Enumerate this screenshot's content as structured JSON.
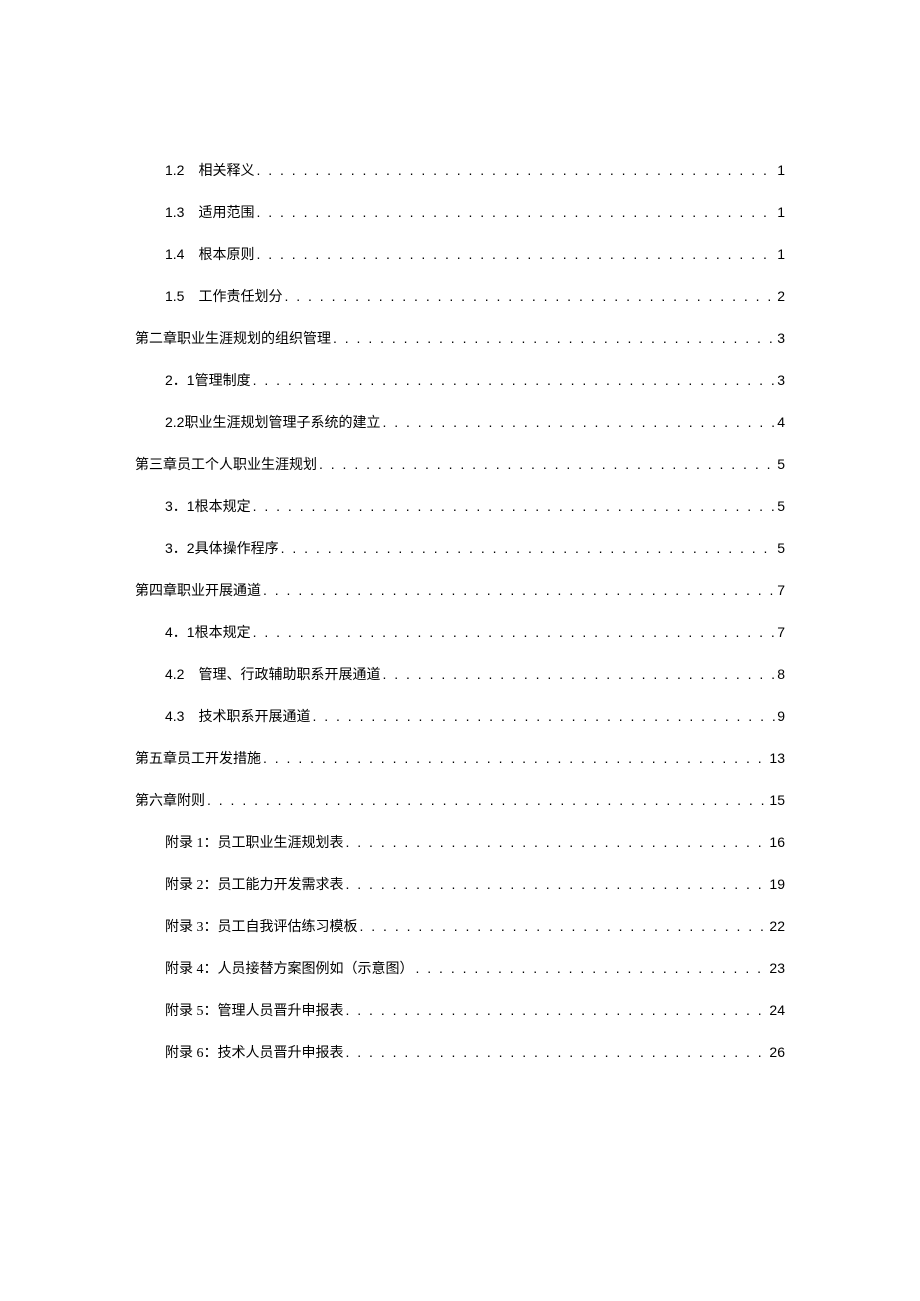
{
  "toc": [
    {
      "level": 2,
      "number": "1.2",
      "title": "相关释义",
      "page": "1",
      "gap": true
    },
    {
      "level": 2,
      "number": "1.3",
      "title": "适用范围",
      "page": "1",
      "gap": true
    },
    {
      "level": 2,
      "number": "1.4",
      "title": "根本原则",
      "page": "1",
      "gap": true
    },
    {
      "level": 2,
      "number": "1.5",
      "title": "工作责任划分",
      "page": "2",
      "gap": true
    },
    {
      "level": 1,
      "number": "",
      "title": "第二章职业生涯规划的组织管理",
      "page": "3",
      "gap": false
    },
    {
      "level": 2,
      "number": "2．1",
      "title": " 管理制度",
      "page": "3",
      "gap": false
    },
    {
      "level": 2,
      "number": "2.2",
      "title": " 职业生涯规划管理子系统的建立",
      "page": "4",
      "gap": false
    },
    {
      "level": 1,
      "number": "",
      "title": "第三章员工个人职业生涯规划",
      "page": "5",
      "gap": false
    },
    {
      "level": 2,
      "number": "3．1",
      "title": " 根本规定",
      "page": "5",
      "gap": false
    },
    {
      "level": 2,
      "number": "3．2",
      "title": " 具体操作程序",
      "page": "5",
      "gap": false
    },
    {
      "level": 1,
      "number": "",
      "title": "第四章职业开展通道",
      "page": "7",
      "gap": false
    },
    {
      "level": 2,
      "number": "4．1",
      "title": " 根本规定",
      "page": "7",
      "gap": false
    },
    {
      "level": 2,
      "number": "4.2",
      "title": "管理、行政辅助职系开展通道",
      "page": "8",
      "gap": true
    },
    {
      "level": 2,
      "number": "4.3",
      "title": "技术职系开展通道",
      "page": "9",
      "gap": true
    },
    {
      "level": 1,
      "number": "",
      "title": "第五章员工开发措施",
      "page": "13",
      "gap": false
    },
    {
      "level": 1,
      "number": "",
      "title": "第六章附则",
      "page": "15",
      "gap": false
    },
    {
      "level": 2,
      "number": "",
      "title": "附录 1：员工职业生涯规划表 ",
      "page": " 16",
      "gap": false
    },
    {
      "level": 2,
      "number": "",
      "title": "附录 2：员工能力开发需求表 ",
      "page": " 19",
      "gap": false
    },
    {
      "level": 2,
      "number": "",
      "title": "附录 3：员工自我评估练习模板 ",
      "page": " 22",
      "gap": false
    },
    {
      "level": 2,
      "number": "",
      "title": "附录 4：人员接替方案图例如（示意图） ",
      "page": " 23",
      "gap": false
    },
    {
      "level": 2,
      "number": "",
      "title": "附录 5：管理人员晋升申报表 ",
      "page": " 24",
      "gap": false
    },
    {
      "level": 2,
      "number": "",
      "title": "附录 6：技术人员晋升申报表 ",
      "page": " 26",
      "gap": false
    }
  ]
}
